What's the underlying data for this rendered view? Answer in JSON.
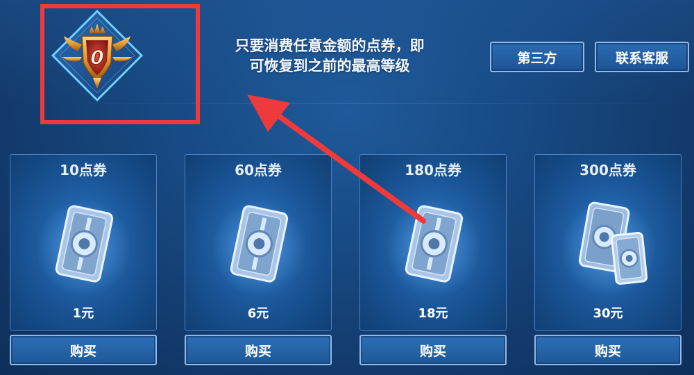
{
  "header": {
    "notice_line1": "只要消费任意金额的点券，即",
    "notice_line2": "可恢复到之前的最高等级",
    "third_party_label": "第三方",
    "customer_service_label": "联系客服"
  },
  "rank_emblem": {
    "icon": "rank-badge-icon",
    "digit": "0"
  },
  "annotation": {
    "highlight_color": "#ee3a3a",
    "arrow_color": "#ee3a3a"
  },
  "packages": [
    {
      "title": "10点券",
      "price": "1元",
      "buy_label": "购买",
      "icon": "coupon-icon"
    },
    {
      "title": "60点券",
      "price": "6元",
      "buy_label": "购买",
      "icon": "coupon-icon"
    },
    {
      "title": "180点券",
      "price": "18元",
      "buy_label": "购买",
      "icon": "coupon-icon"
    },
    {
      "title": "300点券",
      "price": "30元",
      "buy_label": "购买",
      "icon": "coupon-stack-icon"
    }
  ],
  "colors": {
    "background": "#184a84",
    "button_border": "#8fb9e8",
    "card_border": "#4a80c0"
  }
}
